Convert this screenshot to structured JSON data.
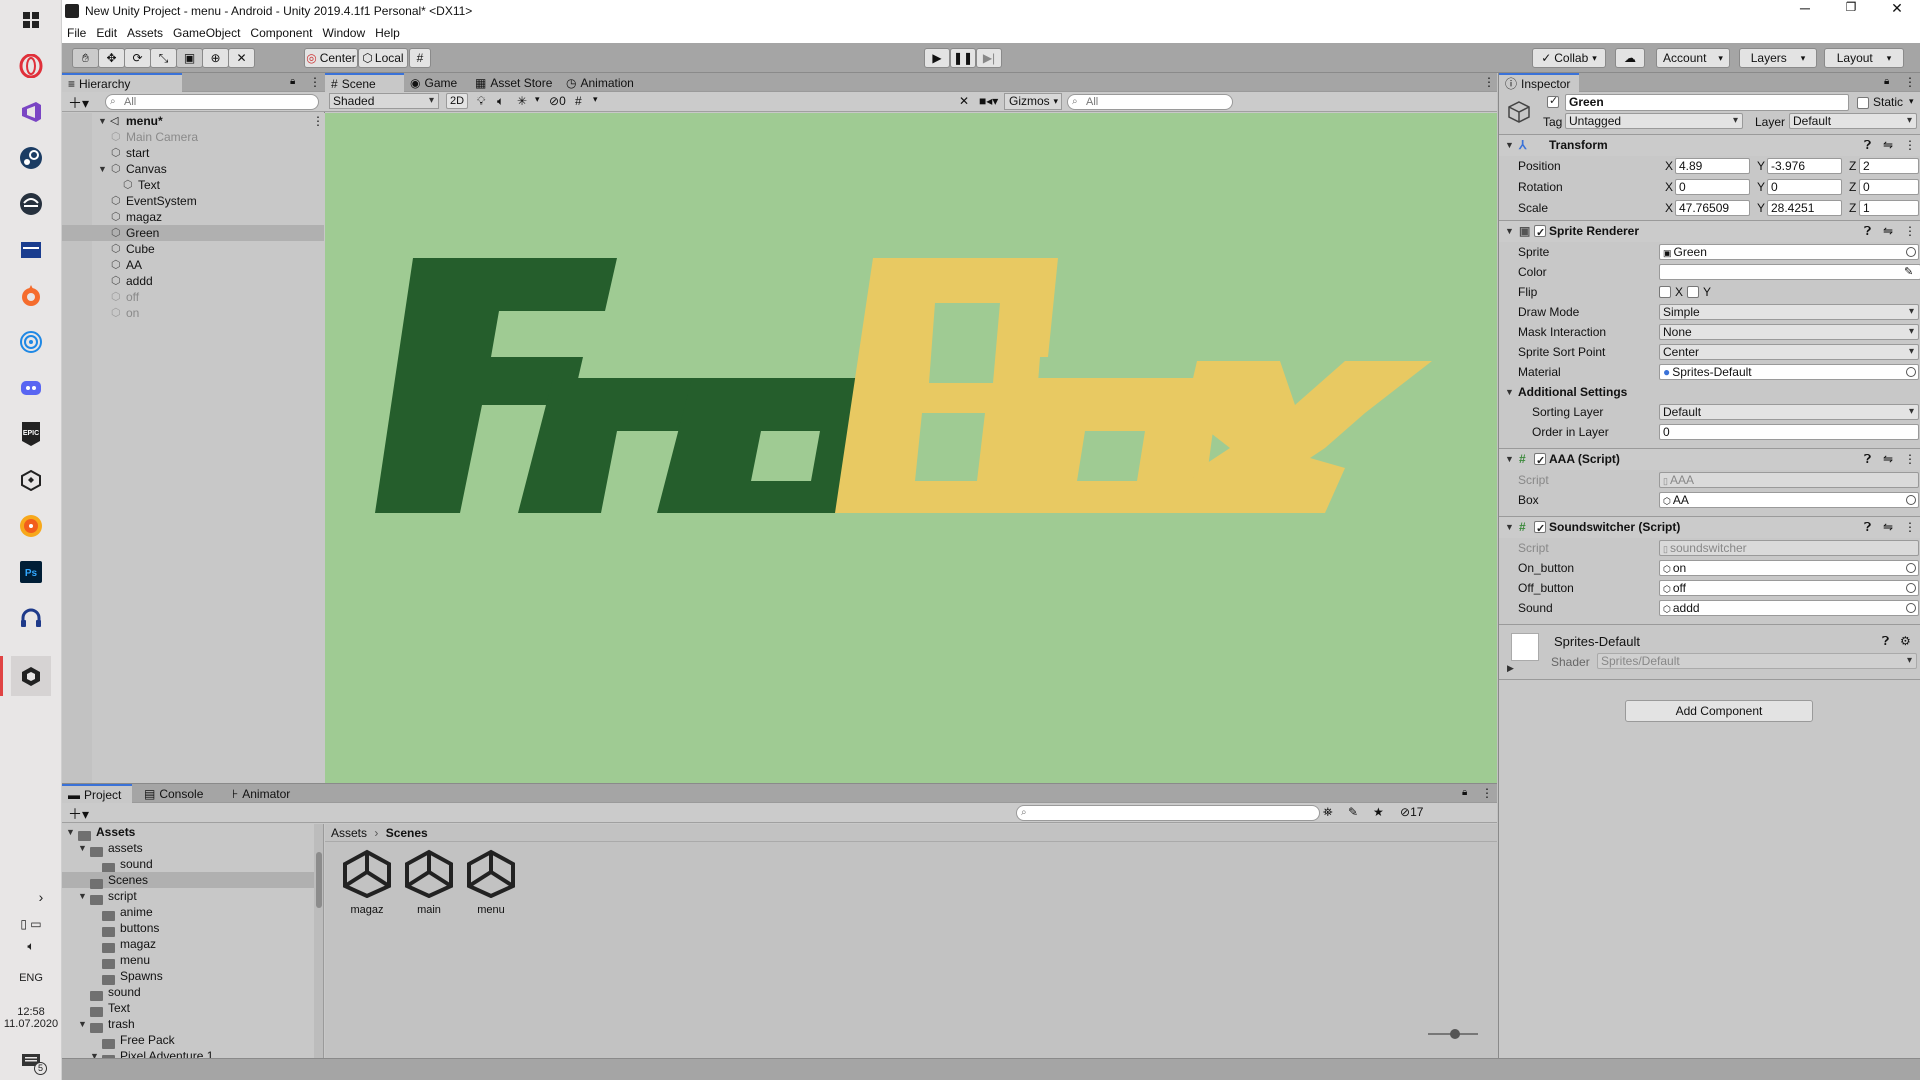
{
  "taskbar": {
    "time": "12:58",
    "date": "11.07.2020",
    "lang": "ENG",
    "notifications_badge": "5",
    "apps": [
      "windows-start-icon",
      "opera-icon",
      "visual-studio-icon",
      "steam-icon",
      "edge-chromium-icon",
      "video-icon",
      "origin-icon",
      "osu-icon",
      "discord-icon",
      "epic-games-icon",
      "unity-hub-icon",
      "itunes-icon",
      "photoshop-icon",
      "headphones-icon",
      "unity-icon"
    ]
  },
  "window": {
    "title": "New Unity Project - menu - Android - Unity 2019.4.1f1 Personal* <DX11>",
    "menu": [
      "File",
      "Edit",
      "Assets",
      "GameObject",
      "Component",
      "Window",
      "Help"
    ]
  },
  "toolbar": {
    "pivot_mode": "Center",
    "pivot_rotation": "Local",
    "collab": "Collab",
    "account": "Account",
    "layers": "Layers",
    "layout": "Layout"
  },
  "hierarchy": {
    "tab": "Hierarchy",
    "search_placeholder": "All",
    "scene": "menu*",
    "items": [
      {
        "label": "Main Camera",
        "dim": true
      },
      {
        "label": "start"
      },
      {
        "label": "Canvas"
      },
      {
        "label": "Text"
      },
      {
        "label": "EventSystem"
      },
      {
        "label": "magaz"
      },
      {
        "label": "Green",
        "selected": true
      },
      {
        "label": "Cube"
      },
      {
        "label": "AA"
      },
      {
        "label": "addd"
      },
      {
        "label": "off",
        "dim": true
      },
      {
        "label": "on",
        "dim": true
      }
    ]
  },
  "scene_view": {
    "tabs": [
      "Scene",
      "Game",
      "Asset Store",
      "Animation"
    ],
    "shading": "Shaded",
    "mode_2d": "2D",
    "hidden_count": "0",
    "gizmos": "Gizmos",
    "search_placeholder": "All",
    "background": "#9fcb93",
    "logo_left": "Fro",
    "logo_right": "Box",
    "logo_left_color": "#255e2c",
    "logo_right_color": "#e8c962"
  },
  "project": {
    "tabs": [
      "Project",
      "Console",
      "Animator"
    ],
    "hidden_count": "17",
    "tree": [
      {
        "label": "Assets",
        "bold": true
      },
      {
        "label": "assets"
      },
      {
        "label": "sound"
      },
      {
        "label": "Scenes",
        "selected": true
      },
      {
        "label": "script"
      },
      {
        "label": "anime"
      },
      {
        "label": "buttons"
      },
      {
        "label": "magaz"
      },
      {
        "label": "menu"
      },
      {
        "label": "Spawns"
      },
      {
        "label": "sound"
      },
      {
        "label": "Text"
      },
      {
        "label": "trash"
      },
      {
        "label": "Free Pack"
      },
      {
        "label": "Pixel Adventure 1"
      }
    ],
    "breadcrumb": [
      "Assets",
      "Scenes"
    ],
    "files": [
      "magaz",
      "main",
      "menu"
    ]
  },
  "inspector": {
    "tab": "Inspector",
    "object_name": "Green",
    "static_label": "Static",
    "tag_label": "Tag",
    "tag": "Untagged",
    "layer_label": "Layer",
    "layer": "Default",
    "transform": {
      "title": "Transform",
      "position_label": "Position",
      "rotation_label": "Rotation",
      "scale_label": "Scale",
      "position": [
        "4.89",
        "-3.976",
        "2"
      ],
      "rotation": [
        "0",
        "0",
        "0"
      ],
      "scale": [
        "47.76509",
        "28.4251",
        "1"
      ]
    },
    "sprite_renderer": {
      "title": "Sprite Renderer",
      "labels": {
        "sprite": "Sprite",
        "color": "Color",
        "flip": "Flip",
        "draw_mode": "Draw Mode",
        "mask": "Mask Interaction",
        "sort_point": "Sprite Sort Point",
        "material": "Material",
        "additional": "Additional Settings",
        "sorting_layer": "Sorting Layer",
        "order": "Order in Layer"
      },
      "sprite": "Green",
      "flip_x": "X",
      "flip_y": "Y",
      "draw_mode": "Simple",
      "mask_interaction": "None",
      "sort_point": "Center",
      "material": "Sprites-Default",
      "sorting_layer": "Default",
      "order_in_layer": "0"
    },
    "aaa_script": {
      "title": "AAA (Script)",
      "script_label": "Script",
      "script": "AAA",
      "box_label": "Box",
      "box": "AA"
    },
    "soundswitcher": {
      "title": "Soundswitcher (Script)",
      "script_label": "Script",
      "script": "soundswitcher",
      "on_label": "On_button",
      "on": "on",
      "off_label": "Off_button",
      "off": "off",
      "sound_label": "Sound",
      "sound": "addd"
    },
    "material_block": {
      "name": "Sprites-Default",
      "shader_label": "Shader",
      "shader": "Sprites/Default"
    },
    "add_component": "Add Component"
  }
}
